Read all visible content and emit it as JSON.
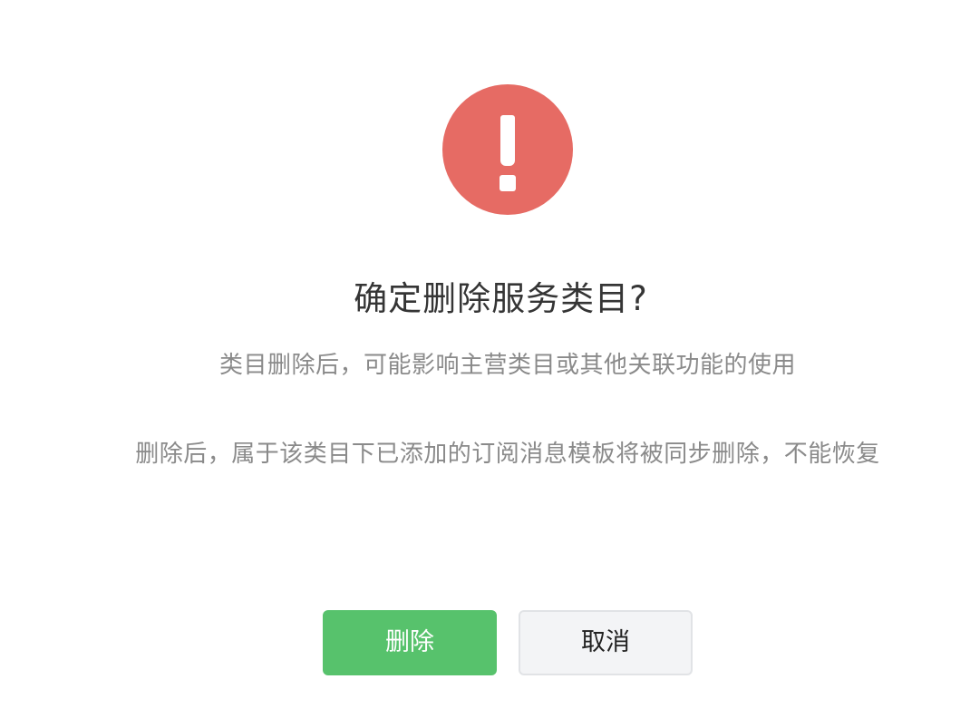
{
  "dialog": {
    "icon": "exclamation-warning-icon",
    "icon_color": "#e66b64",
    "title": "确定删除服务类目?",
    "description_1": "类目删除后，可能影响主营类目或其他关联功能的使用",
    "description_2": "删除后，属于该类目下已添加的订阅消息模板将被同步删除，不能恢复",
    "confirm_label": "删除",
    "confirm_color": "#57c26c",
    "cancel_label": "取消"
  }
}
